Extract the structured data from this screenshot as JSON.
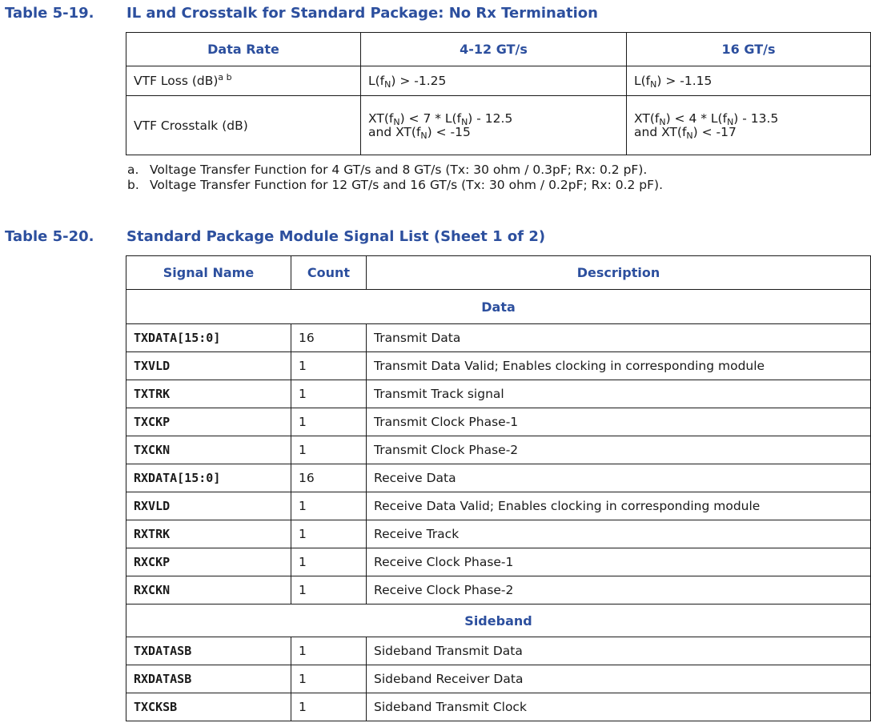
{
  "table1": {
    "number": "Table 5-19.",
    "title": "IL and Crosstalk for Standard Package: No Rx Termination",
    "headers": [
      "Data Rate",
      "4-12 GT/s",
      "16 GT/s"
    ],
    "loss": {
      "label": "VTF Loss (dB)",
      "footnote_marks": "a b",
      "col1": {
        "pre": "L(f",
        "sub": "N",
        "post": ") > -1.25"
      },
      "col2": {
        "pre": "L(f",
        "sub": "N",
        "post": ") > -1.15"
      }
    },
    "crosstalk": {
      "label": "VTF Crosstalk (dB)",
      "col1": {
        "l1a": "XT(f",
        "l1s1": "N",
        "l1b": ") < 7 * L(f",
        "l1s2": "N",
        "l1c": ") - 12.5",
        "l2a": "and XT(f",
        "l2s": "N",
        "l2b": ") < -15"
      },
      "col2": {
        "l1a": "XT(f",
        "l1s1": "N",
        "l1b": ") < 4 * L(f",
        "l1s2": "N",
        "l1c": ") - 13.5",
        "l2a": "and XT(f",
        "l2s": "N",
        "l2b": ") < -17"
      }
    },
    "footnotes": [
      {
        "letter": "a.",
        "text": "Voltage Transfer Function for 4 GT/s and 8 GT/s (Tx: 30 ohm / 0.3pF; Rx: 0.2 pF)."
      },
      {
        "letter": "b.",
        "text": "Voltage Transfer Function for 12 GT/s and 16 GT/s (Tx: 30 ohm / 0.2pF; Rx: 0.2 pF)."
      }
    ]
  },
  "table2": {
    "number": "Table 5-20.",
    "title": "Standard Package Module Signal List (Sheet 1 of 2)",
    "headers": [
      "Signal Name",
      "Count",
      "Description"
    ],
    "section_data": "Data",
    "data_rows": [
      {
        "name": "TXDATA[15:0]",
        "count": "16",
        "desc": "Transmit Data"
      },
      {
        "name": "TXVLD",
        "count": "1",
        "desc": "Transmit Data Valid; Enables clocking in corresponding module"
      },
      {
        "name": "TXTRK",
        "count": "1",
        "desc": "Transmit Track signal"
      },
      {
        "name": "TXCKP",
        "count": "1",
        "desc": "Transmit Clock Phase-1"
      },
      {
        "name": "TXCKN",
        "count": "1",
        "desc": "Transmit Clock Phase-2"
      },
      {
        "name": "RXDATA[15:0]",
        "count": "16",
        "desc": "Receive Data"
      },
      {
        "name": "RXVLD",
        "count": "1",
        "desc": "Receive Data Valid; Enables clocking in corresponding module"
      },
      {
        "name": "RXTRK",
        "count": "1",
        "desc": "Receive Track"
      },
      {
        "name": "RXCKP",
        "count": "1",
        "desc": "Receive Clock Phase-1"
      },
      {
        "name": "RXCKN",
        "count": "1",
        "desc": "Receive Clock Phase-2"
      }
    ],
    "section_sideband": "Sideband",
    "sideband_rows": [
      {
        "name": "TXDATASB",
        "count": "1",
        "desc": "Sideband Transmit Data"
      },
      {
        "name": "RXDATASB",
        "count": "1",
        "desc": "Sideband Receiver Data"
      },
      {
        "name": "TXCKSB",
        "count": "1",
        "desc": "Sideband Transmit Clock"
      }
    ]
  }
}
